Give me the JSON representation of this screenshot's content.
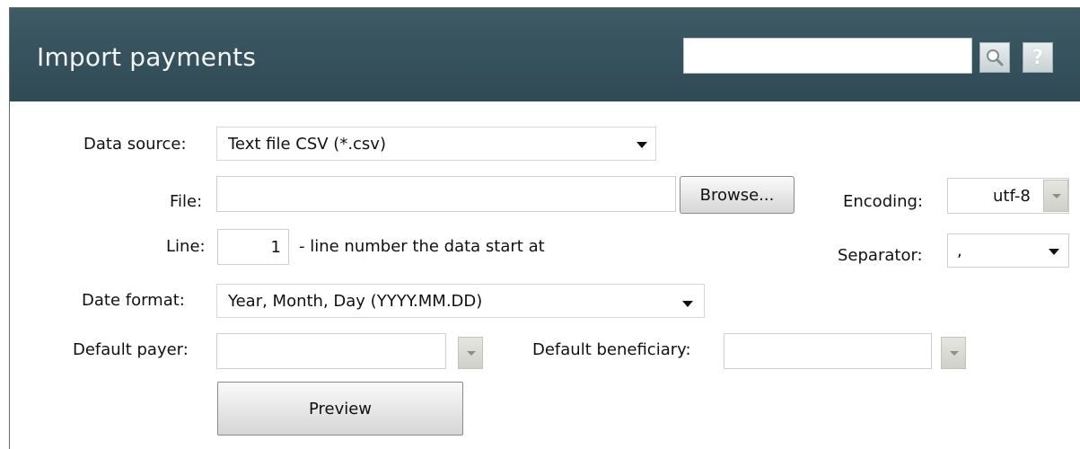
{
  "header": {
    "title": "Import payments",
    "search_value": "",
    "help_label": "?"
  },
  "form": {
    "data_source": {
      "label": "Data source:",
      "value": "Text file CSV (*.csv)"
    },
    "file": {
      "label": "File:",
      "value": "",
      "browse_label": "Browse..."
    },
    "encoding": {
      "label": "Encoding:",
      "value": "utf-8"
    },
    "line": {
      "label": "Line:",
      "value": "1",
      "hint": "- line number the data start at"
    },
    "separator": {
      "label": "Separator:",
      "value": ","
    },
    "date_format": {
      "label": "Date format:",
      "value": "Year, Month, Day (YYYY.MM.DD)"
    },
    "default_payer": {
      "label": "Default payer:",
      "value": ""
    },
    "default_beneficiary": {
      "label": "Default beneficiary:",
      "value": ""
    },
    "preview_label": "Preview"
  },
  "colors": {
    "header_bg": "#34505b",
    "header_text": "#f2f6f7"
  },
  "icons": {
    "search": "magnifier-icon",
    "help": "question-icon"
  }
}
